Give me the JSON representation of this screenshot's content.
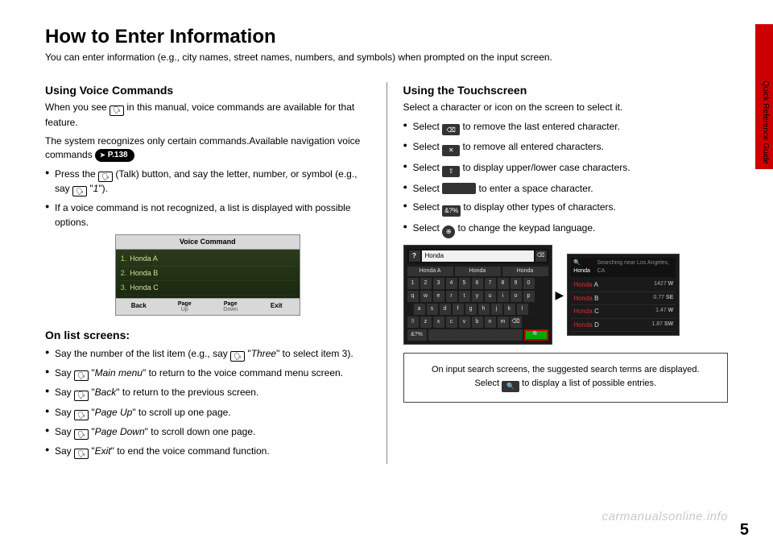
{
  "title": "How to Enter Information",
  "subtitle": "You can enter information (e.g., city names, street names, numbers, and symbols) when prompted on the input screen.",
  "left": {
    "voice_h": "Using Voice Commands",
    "voice_p1a": "When you see ",
    "voice_p1b": " in this manual, voice commands are available for that feature.",
    "voice_p2": "The system recognizes only certain commands.Available navigation voice commands ",
    "page_ref": "P.138",
    "b1a": "Press the ",
    "b1b": " (Talk) button, and say the letter, number, or symbol (e.g., say ",
    "b1c": " \"",
    "b1_say": "1",
    "b1d": "\").",
    "b2": "If a voice command is not recognized, a list is displayed with possible options.",
    "vc_header": "Voice Command",
    "vc_items": [
      "Honda A",
      "Honda B",
      "Honda C"
    ],
    "vc_footer": {
      "back": "Back",
      "pu": "Page",
      "pu_sub": "Up",
      "pd": "Page",
      "pd_sub": "Down",
      "exit": "Exit"
    },
    "list_h": "On list screens:",
    "l1a": "Say the number of the list item (e.g., say ",
    "l1b": " \"",
    "l1_say": "Three",
    "l1c": "\" to select item 3).",
    "l2a": "Say ",
    "l2_say": "Main menu",
    "l2b": "\" to return to the voice command menu screen.",
    "l3a": "Say ",
    "l3_say": "Back",
    "l3b": "\" to return to the previous screen.",
    "l4a": "Say ",
    "l4_say": "Page Up",
    "l4b": "\" to scroll up one page.",
    "l5a": "Say ",
    "l5_say": "Page Down",
    "l5b": "\" to scroll down one page.",
    "l6a": "Say ",
    "l6_say": "Exit",
    "l6b": "\" to end the voice command function."
  },
  "right": {
    "touch_h": "Using the Touchscreen",
    "touch_p": "Select a character or icon on the screen to select it.",
    "r1": " to remove the last entered character.",
    "r2": " to remove all entered characters.",
    "r3": " to display upper/lower case characters.",
    "r4": " to enter a space character.",
    "r5": " to display other types of characters.",
    "r6": " to change the keypad language.",
    "sel": "Select ",
    "kb": {
      "query": "Honda",
      "suggest": [
        "Honda A",
        "Honda",
        "Honda"
      ],
      "row1": [
        "1",
        "2",
        "3",
        "4",
        "5",
        "6",
        "7",
        "8",
        "9",
        "0"
      ],
      "row2": [
        "q",
        "w",
        "e",
        "r",
        "t",
        "y",
        "u",
        "i",
        "o",
        "p"
      ],
      "row3": [
        "a",
        "s",
        "d",
        "f",
        "g",
        "h",
        "j",
        "k",
        "l"
      ],
      "row4": [
        "⇧",
        "z",
        "x",
        "c",
        "v",
        "b",
        "n",
        "m",
        "⌫"
      ],
      "row5_left": "&?%",
      "row5_space": " "
    },
    "results": {
      "header_q": "Honda",
      "header_loc": "Searching near Los Angeles, CA",
      "rows": [
        {
          "name": "Honda A",
          "dist": "1427",
          "dir": "W"
        },
        {
          "name": "Honda B",
          "dist": "0.77",
          "dir": "SE"
        },
        {
          "name": "Honda C",
          "dist": "1.47",
          "dir": "W"
        },
        {
          "name": "Honda D",
          "dist": "1.87",
          "dir": "SW"
        }
      ]
    },
    "note1": "On input search screens, the suggested search terms are displayed. Select ",
    "note2": " to display a list of possible entries."
  },
  "side_label": "Quick Reference Guide",
  "page_num": "5",
  "watermark": "carmanualsonline.info",
  "icons": {
    "voice": "⎌",
    "backspace": "⌫",
    "clear": "✕",
    "shift": "⇧",
    "space": " ",
    "sym": "&?%",
    "globe": "⊕",
    "mag": "🔍",
    "q": "?"
  }
}
